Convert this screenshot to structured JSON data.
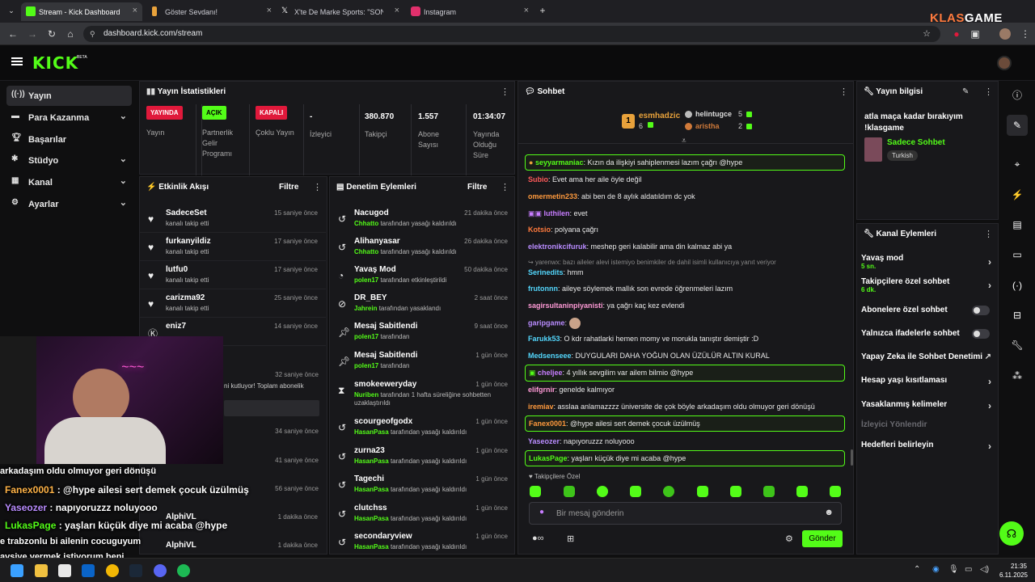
{
  "browser": {
    "tabs": [
      {
        "title": "Stream - Kick Dashboard",
        "color": "#53fc18"
      },
      {
        "title": "Göster Sevdanı!",
        "color": "#e9a23b"
      },
      {
        "title": "X'te De Marke Sports: \"SON DA",
        "color": "#000000"
      },
      {
        "title": "Instagram",
        "color": "#e1306c"
      }
    ],
    "url": "dashboard.kick.com/stream",
    "watermark_a": "KLAS",
    "watermark_b": "GAME"
  },
  "header": {
    "logo": "KICK",
    "beta": "BETA"
  },
  "nav": [
    {
      "label": "Yayın",
      "icon": "broadcast-icon",
      "chev": false
    },
    {
      "label": "Para Kazanma",
      "icon": "money-icon",
      "chev": true
    },
    {
      "label": "Başarılar",
      "icon": "trophy-icon",
      "chev": false
    },
    {
      "label": "Stüdyo",
      "icon": "studio-icon",
      "chev": true
    },
    {
      "label": "Kanal",
      "icon": "channel-icon",
      "chev": true
    },
    {
      "label": "Ayarlar",
      "icon": "settings-icon",
      "chev": true
    }
  ],
  "stats": {
    "title": "Yayın İstatistikleri",
    "cols": [
      {
        "badge": "YAYINDA",
        "badge_color": "#e0193b",
        "label": "Yayın"
      },
      {
        "badge": "AÇIK",
        "badge_color": "#53fc18",
        "label": "Partnerlik Gelir Programı"
      },
      {
        "badge": "KAPALI",
        "badge_color": "#e0193b",
        "label": "Çoklu Yayın"
      },
      {
        "value": "-",
        "label": "İzleyici"
      },
      {
        "value": "380.870",
        "label": "Takipçi"
      },
      {
        "value": "1.557",
        "label": "Abone Sayısı"
      },
      {
        "value": "01:34:07",
        "label": "Yayında Olduğu Süre"
      }
    ]
  },
  "activity": {
    "title": "Etkinlik Akışı",
    "filter": "Filtre",
    "rows": [
      {
        "name": "SadeceSet",
        "sub": "kanalı takip etti",
        "time": "15 saniye önce"
      },
      {
        "name": "furkanyildiz",
        "sub": "kanalı takip etti",
        "time": "17 saniye önce"
      },
      {
        "name": "lutfu0",
        "sub": "kanalı takip etti",
        "time": "17 saniye önce"
      },
      {
        "name": "carizma92",
        "sub": "kanalı takip etti",
        "time": "25 saniye önce"
      },
      {
        "name": "eniz7",
        "sub": "",
        "time": "14 saniye önce"
      }
    ],
    "partial": [
      {
        "text": "32 saniye önce"
      },
      {
        "text": "ni kutluyor! Toplam abonelik"
      },
      {
        "text": "34 saniye önce"
      },
      {
        "text": "41 saniye önce"
      },
      {
        "text": "56 saniye önce"
      }
    ],
    "tail": [
      {
        "name": "AlphiVL",
        "time": "1 dakika önce"
      },
      {
        "name": "AlphiVL",
        "time": "1 dakika önce"
      }
    ]
  },
  "moderation": {
    "title": "Denetim Eylemleri",
    "filter": "Filtre",
    "rows": [
      {
        "name": "Nacugod",
        "actor": "Chhatto",
        "action": "tarafından yasağı kaldırıldı",
        "time": "21 dakika önce",
        "icon": "undo-icon"
      },
      {
        "name": "Alihanyasar",
        "actor": "Chhatto",
        "action": "tarafından yasağı kaldırıldı",
        "time": "26 dakika önce",
        "icon": "undo-icon"
      },
      {
        "name": "Yavaş Mod",
        "actor": "polen17",
        "action": "tarafından etkinleştirildi",
        "time": "50 dakika önce",
        "icon": "slow-icon"
      },
      {
        "name": "DR_BEY",
        "actor": "Jahrein",
        "action": "tarafından yasaklandı",
        "time": "2 saat önce",
        "icon": "ban-icon"
      },
      {
        "name": "Mesaj Sabitlendi",
        "actor": "polen17",
        "action": "tarafından",
        "time": "9 saat önce",
        "icon": "pin-icon"
      },
      {
        "name": "Mesaj Sabitlendi",
        "actor": "polen17",
        "action": "tarafından",
        "time": "1 gün önce",
        "icon": "pin-icon"
      },
      {
        "name": "smokeeweryday",
        "actor": "Nuriben",
        "action": "tarafından 1 hafta süreliğine sohbetten uzaklaştırıldı",
        "time": "1 gün önce",
        "icon": "hourglass-icon"
      },
      {
        "name": "scourgeofgodx",
        "actor": "HasanPasa",
        "action": "tarafından yasağı kaldırıldı",
        "time": "1 gün önce",
        "icon": "undo-icon"
      },
      {
        "name": "zurna23",
        "actor": "HasanPasa",
        "action": "tarafından yasağı kaldırıldı",
        "time": "1 gün önce",
        "icon": "undo-icon"
      },
      {
        "name": "Tagechi",
        "actor": "HasanPasa",
        "action": "tarafından yasağı kaldırıldı",
        "time": "1 gün önce",
        "icon": "undo-icon"
      },
      {
        "name": "clutchss",
        "actor": "HasanPasa",
        "action": "tarafından yasağı kaldırıldı",
        "time": "1 gün önce",
        "icon": "undo-icon"
      },
      {
        "name": "secondaryview",
        "actor": "HasanPasa",
        "action": "tarafından yasağı kaldırıldı",
        "time": "1 gün önce",
        "icon": "undo-icon"
      }
    ]
  },
  "chat": {
    "title": "Sohbet",
    "top": [
      {
        "rank": "1",
        "name": "esmhadzic",
        "count": "6"
      },
      {
        "rank": "2",
        "name": "helintugce",
        "count": "5"
      },
      {
        "rank": "3",
        "name": "aristha",
        "count": "2"
      }
    ],
    "messages": [
      {
        "user": "seyyarmaniac",
        "color": "#53fc18",
        "text": ": Kızın da ilişkiyi sahiplenmesi lazım çağrı @hype",
        "hl": true
      },
      {
        "user": "Subio",
        "color": "#ff5a5a",
        "text": ": Evet ama her aile öyle değil",
        "hl": false
      },
      {
        "user": "omermetin233",
        "color": "#ff9a3d",
        "text": ": abi ben de 8 aylık aldatıldım dc yok",
        "hl": false
      },
      {
        "user": "luthilen",
        "color": "#c77dff",
        "text": ": evet",
        "hl": false
      },
      {
        "user": "Kotsio",
        "color": "#ff7a3d",
        "text": ": polyana çağrı",
        "hl": false
      },
      {
        "user": "elektronikcifuruk",
        "color": "#b98cff",
        "text": ": meshep geri kalabilir ama din kalmaz abi ya",
        "hl": false
      },
      {
        "user": "yarenwx",
        "color": "#888888",
        "text": ": bazı aileler alevi istemiyo benimkiler de dahil isimli kullanıcıya yanıt veriyor",
        "hl": false
      },
      {
        "user": "Serinedits",
        "color": "#53d6fc",
        "text": ": hmm",
        "hl": false
      },
      {
        "user": "frutonnn",
        "color": "#53d6fc",
        "text": ": aileye söylemek mallık son evrede öğrenmeleri lazım",
        "hl": false
      },
      {
        "user": "sagirsultaninpiyanisti",
        "color": "#ff9ad6",
        "text": ": ya çağrı kaç kez evlendi",
        "hl": false
      },
      {
        "user": "garipgame",
        "color": "#b98cff",
        "text": ":",
        "hl": false
      },
      {
        "user": "Farukk53",
        "color": "#53d6fc",
        "text": ": O kdr rahatlarki hemen momy ve morukla tanıştır demiştir :D",
        "hl": false
      },
      {
        "user": "Medsenseee",
        "color": "#53d6fc",
        "text": ": DUYGULARI DAHA YOĞUN OLAN ÜZÜLÜR ALTIN KURAL",
        "hl": false
      },
      {
        "user": "cheljee",
        "color": "#c77dff",
        "text": ": 4 yıllık sevgilim var ailem bilmio @hype",
        "hl": true
      },
      {
        "user": "elifgrnir",
        "color": "#ff9ad6",
        "text": ": genelde kalmıyor",
        "hl": false
      },
      {
        "user": "iremiav",
        "color": "#ff9a3d",
        "text": ": asslaa anlamazzzz üniversite de çok böyle arkadaşım oldu olmuyor geri dönüşü",
        "hl": false
      },
      {
        "user": "Fanex0001",
        "color": "#ff9a3d",
        "text": ": @hype ailesi sert demek çocuk üzülmüş",
        "hl": true
      },
      {
        "user": "Yaseozer",
        "color": "#b98cff",
        "text": ": napıyoruzzz noluyooo",
        "hl": false
      },
      {
        "user": "LukasPage",
        "color": "#53fc18",
        "text": ": yaşları küçük diye mi acaba @hype",
        "hl": true
      }
    ],
    "followers_only": "Takipçilere Özel",
    "placeholder": "Bir mesaj gönderin",
    "send": "Gönder"
  },
  "info": {
    "title": "Yayın bilgisi",
    "stream_title": "atla maça kadar bırakıyım !klasgame",
    "category": "Sadece Sohbet",
    "tag": "Turkish"
  },
  "channel_actions": {
    "title": "Kanal Eylemleri",
    "rows": [
      {
        "label": "Yavaş mod",
        "sub": "5 sn.",
        "kind": "chev"
      },
      {
        "label": "Takipçilere özel sohbet",
        "sub": "6 dk.",
        "kind": "chev"
      },
      {
        "label": "Abonelere özel sohbet",
        "sub": "",
        "kind": "toggle"
      },
      {
        "label": "Yalnızca ifadelerle sohbet",
        "sub": "",
        "kind": "toggle"
      },
      {
        "label": "Yapay Zeka ile Sohbet Denetimi",
        "sub": "",
        "kind": "ext"
      },
      {
        "label": "Hesap yaşı kısıtlaması",
        "sub": "",
        "kind": "chev"
      },
      {
        "label": "Yasaklanmış kelimeler",
        "sub": "",
        "kind": "chev"
      },
      {
        "label": "İzleyici Yönlendir",
        "sub": "",
        "kind": "dim"
      },
      {
        "label": "Hedefleri belirleyin",
        "sub": "",
        "kind": "chev"
      }
    ]
  },
  "overlay": {
    "lines": [
      {
        "user": "",
        "color": "#ffffff",
        "text": "arkadaşım oldu olmuyor geri dönüşü"
      },
      {
        "user": "Fanex0001",
        "color": "#ffb347",
        "text": " : @hype ailesi sert demek çocuk üzülmüş"
      },
      {
        "user": "Yaseozer",
        "color": "#b98cff",
        "text": " : napıyoruzzz noluyooo"
      },
      {
        "user": "LukasPage",
        "color": "#53fc18",
        "text": " : yaşları küçük diye mi acaba @hype"
      },
      {
        "user": "",
        "color": "#ffffff",
        "text": "e trabzonlu bi ailenin cocuguyum"
      },
      {
        "user": "",
        "color": "#ffffff",
        "text": "avsiye vermek istiyorum beni"
      }
    ]
  },
  "taskbar": {
    "time": "21:35",
    "date": "6.11.2025"
  }
}
